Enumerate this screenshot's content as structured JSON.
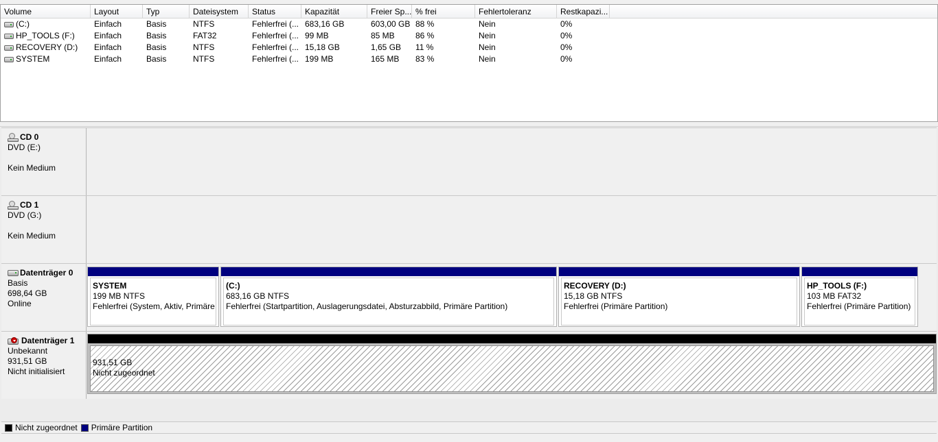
{
  "volume_list": {
    "columns": [
      "Volume",
      "Layout",
      "Typ",
      "Dateisystem",
      "Status",
      "Kapazität",
      "Freier Sp...",
      "% frei",
      "Fehlertoleranz",
      "Restkapazi..."
    ],
    "rows": [
      {
        "volume": "(C:)",
        "layout": "Einfach",
        "typ": "Basis",
        "dateisystem": "NTFS",
        "status": "Fehlerfrei (...",
        "kapazitaet": "683,16 GB",
        "frei": "603,00 GB",
        "prozent": "88 %",
        "fehlertoleranz": "Nein",
        "rest": "0%"
      },
      {
        "volume": "HP_TOOLS (F:)",
        "layout": "Einfach",
        "typ": "Basis",
        "dateisystem": "FAT32",
        "status": "Fehlerfrei (...",
        "kapazitaet": "99 MB",
        "frei": "85 MB",
        "prozent": "86 %",
        "fehlertoleranz": "Nein",
        "rest": "0%"
      },
      {
        "volume": "RECOVERY (D:)",
        "layout": "Einfach",
        "typ": "Basis",
        "dateisystem": "NTFS",
        "status": "Fehlerfrei (...",
        "kapazitaet": "15,18 GB",
        "frei": "1,65 GB",
        "prozent": "11 %",
        "fehlertoleranz": "Nein",
        "rest": "0%"
      },
      {
        "volume": "SYSTEM",
        "layout": "Einfach",
        "typ": "Basis",
        "dateisystem": "NTFS",
        "status": "Fehlerfrei (...",
        "kapazitaet": "199 MB",
        "frei": "165 MB",
        "prozent": "83 %",
        "fehlertoleranz": "Nein",
        "rest": "0%"
      }
    ]
  },
  "disks": {
    "cd0": {
      "title": "CD 0",
      "line1": "DVD (E:)",
      "line2": "Kein Medium"
    },
    "cd1": {
      "title": "CD 1",
      "line1": "DVD (G:)",
      "line2": "Kein Medium"
    },
    "disk0": {
      "title": "Datenträger 0",
      "line1": "Basis",
      "line2": "698,64 GB",
      "line3": "Online",
      "partitions": [
        {
          "name": "SYSTEM",
          "size": "199 MB NTFS",
          "status": "Fehlerfrei (System, Aktiv, Primäre"
        },
        {
          "name": "(C:)",
          "size": "683,16 GB NTFS",
          "status": "Fehlerfrei (Startpartition, Auslagerungsdatei, Absturzabbild, Primäre Partition)"
        },
        {
          "name": "RECOVERY  (D:)",
          "size": "15,18 GB NTFS",
          "status": "Fehlerfrei (Primäre Partition)"
        },
        {
          "name": "HP_TOOLS  (F:)",
          "size": "103 MB FAT32",
          "status": "Fehlerfrei (Primäre Partition)"
        }
      ]
    },
    "disk1": {
      "title": "Datenträger 1",
      "line1": "Unbekannt",
      "line2": "931,51 GB",
      "line3": "Nicht initialisiert",
      "unallocated": {
        "size": "931,51 GB",
        "label": "Nicht zugeordnet"
      }
    }
  },
  "legend": {
    "items": [
      {
        "label": "Nicht zugeordnet",
        "color": "#000000"
      },
      {
        "label": "Primäre Partition",
        "color": "#00007f"
      }
    ]
  }
}
